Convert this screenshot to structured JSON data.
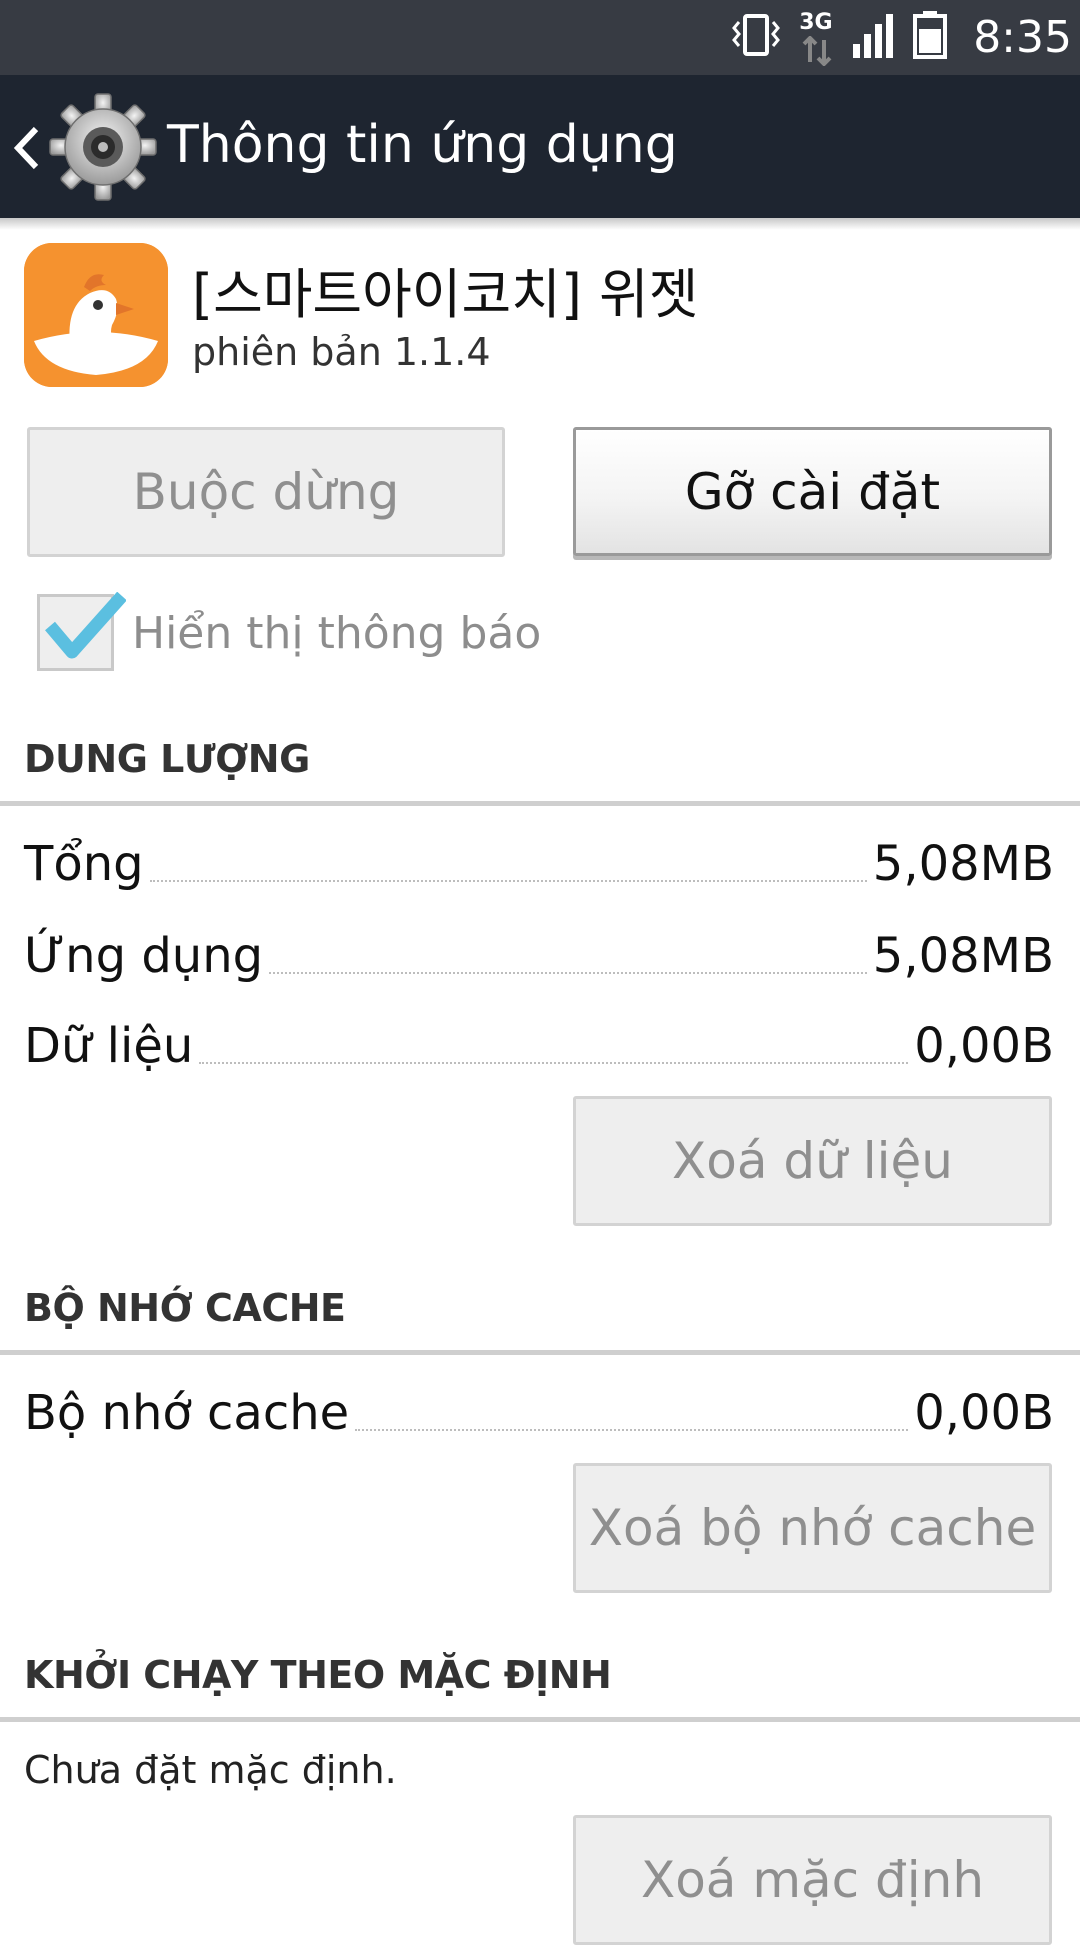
{
  "status_bar": {
    "time": "8:35",
    "icons": [
      "vibrate-icon",
      "network-3g-icon",
      "signal-icon",
      "battery-icon"
    ],
    "network_label": "3G"
  },
  "action_bar": {
    "title": "Thông tin ứng dụng",
    "background": "#1e2530"
  },
  "app": {
    "name": "[스마트아이코치] 위젯",
    "version": "phiên bản 1.1.4",
    "icon": "app-chicken-icon",
    "icon_color": "#f5922f"
  },
  "buttons": {
    "force_stop": "Buộc dừng",
    "uninstall": "Gỡ cài đặt",
    "clear_data": "Xoá dữ liệu",
    "clear_cache": "Xoá bộ nhớ cache",
    "clear_defaults": "Xoá mặc định"
  },
  "notifications": {
    "label": "Hiển thị thông báo",
    "checked": true,
    "check_color": "#5bbfe0"
  },
  "storage": {
    "title": "DUNG LƯỢNG",
    "rows": [
      {
        "label": "Tổng",
        "value": "5,08MB"
      },
      {
        "label": "Ứng dụng",
        "value": "5,08MB"
      },
      {
        "label": "Dữ liệu",
        "value": "0,00B"
      }
    ]
  },
  "cache": {
    "title": "BỘ NHỚ CACHE",
    "rows": [
      {
        "label": "Bộ nhớ cache",
        "value": "0,00B"
      }
    ]
  },
  "launch_default": {
    "title": "KHỞI CHẠY THEO MẶC ĐỊNH",
    "text": "Chưa đặt mặc định."
  }
}
